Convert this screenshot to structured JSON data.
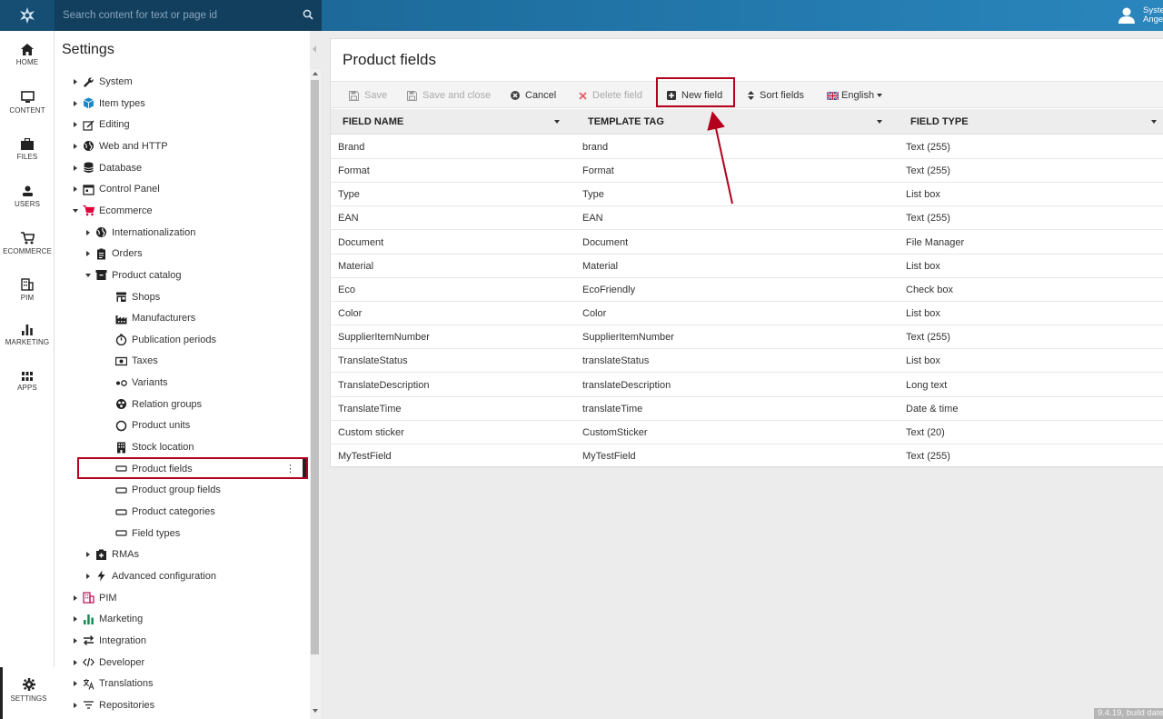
{
  "search": {
    "placeholder": "Search content for text or page id"
  },
  "user": {
    "line1": "System",
    "line2": "Angel"
  },
  "rail": [
    {
      "label": "HOME",
      "icon": "home-icon"
    },
    {
      "label": "CONTENT",
      "icon": "monitor-icon"
    },
    {
      "label": "FILES",
      "icon": "briefcase-icon"
    },
    {
      "label": "USERS",
      "icon": "user-icon"
    },
    {
      "label": "ECOMMERCE",
      "icon": "cart-icon"
    },
    {
      "label": "PIM",
      "icon": "building-icon"
    },
    {
      "label": "MARKETING",
      "icon": "bar-chart-icon"
    },
    {
      "label": "APPS",
      "icon": "grid-icon"
    }
  ],
  "rail_settings": {
    "label": "SETTINGS",
    "icon": "gear-icon"
  },
  "tree": {
    "title": "Settings",
    "nodes": [
      {
        "label": "System",
        "icon": "wrench-icon",
        "level": 0,
        "state": "collapsed"
      },
      {
        "label": "Item types",
        "icon": "cube-icon",
        "level": 0,
        "state": "collapsed"
      },
      {
        "label": "Editing",
        "icon": "edit-icon",
        "level": 0,
        "state": "collapsed"
      },
      {
        "label": "Web and HTTP",
        "icon": "globe-icon",
        "level": 0,
        "state": "collapsed"
      },
      {
        "label": "Database",
        "icon": "database-icon",
        "level": 0,
        "state": "collapsed"
      },
      {
        "label": "Control Panel",
        "icon": "calendar-icon",
        "level": 0,
        "state": "collapsed"
      },
      {
        "label": "Ecommerce",
        "icon": "cart-icon",
        "level": 0,
        "state": "expanded"
      },
      {
        "label": "Internationalization",
        "icon": "globe-icon",
        "level": 1,
        "state": "collapsed"
      },
      {
        "label": "Orders",
        "icon": "clipboard-icon",
        "level": 1,
        "state": "collapsed"
      },
      {
        "label": "Product catalog",
        "icon": "archive-icon",
        "level": 1,
        "state": "expanded"
      },
      {
        "label": "Shops",
        "icon": "store-icon",
        "level": 2,
        "state": "leaf"
      },
      {
        "label": "Manufacturers",
        "icon": "industry-icon",
        "level": 2,
        "state": "leaf"
      },
      {
        "label": "Publication periods",
        "icon": "timer-icon",
        "level": 2,
        "state": "leaf"
      },
      {
        "label": "Taxes",
        "icon": "money-icon",
        "level": 2,
        "state": "leaf"
      },
      {
        "label": "Variants",
        "icon": "variants-icon",
        "level": 2,
        "state": "leaf"
      },
      {
        "label": "Relation groups",
        "icon": "relation-icon",
        "level": 2,
        "state": "leaf"
      },
      {
        "label": "Product units",
        "icon": "circle-icon",
        "level": 2,
        "state": "leaf"
      },
      {
        "label": "Stock location",
        "icon": "building-icon",
        "level": 2,
        "state": "leaf"
      },
      {
        "label": "Product fields",
        "icon": "field-icon",
        "level": 2,
        "state": "leaf"
      },
      {
        "label": "Product group fields",
        "icon": "field-icon",
        "level": 2,
        "state": "leaf"
      },
      {
        "label": "Product categories",
        "icon": "field-icon",
        "level": 2,
        "state": "leaf"
      },
      {
        "label": "Field types",
        "icon": "field-icon",
        "level": 2,
        "state": "leaf"
      },
      {
        "label": "RMAs",
        "icon": "rma-icon",
        "level": 1,
        "state": "collapsed"
      },
      {
        "label": "Advanced configuration",
        "icon": "bolt-icon",
        "level": 1,
        "state": "collapsed"
      },
      {
        "label": "PIM",
        "icon": "pim-icon",
        "level": 0,
        "state": "collapsed"
      },
      {
        "label": "Marketing",
        "icon": "bar-chart-icon",
        "level": 0,
        "state": "collapsed"
      },
      {
        "label": "Integration",
        "icon": "exchange-icon",
        "level": 0,
        "state": "collapsed"
      },
      {
        "label": "Developer",
        "icon": "code-icon",
        "level": 0,
        "state": "collapsed"
      },
      {
        "label": "Translations",
        "icon": "translate-icon",
        "level": 0,
        "state": "collapsed"
      },
      {
        "label": "Repositories",
        "icon": "filter-icon",
        "level": 0,
        "state": "collapsed"
      }
    ]
  },
  "main": {
    "title": "Product fields",
    "toolbar": {
      "save": "Save",
      "save_close": "Save and close",
      "cancel": "Cancel",
      "delete": "Delete field",
      "new_field": "New field",
      "sort": "Sort fields",
      "language": "English"
    },
    "columns": [
      "FIELD NAME",
      "TEMPLATE TAG",
      "FIELD TYPE"
    ],
    "rows": [
      [
        "Brand",
        "brand",
        "Text (255)"
      ],
      [
        "Format",
        "Format",
        "Text (255)"
      ],
      [
        "Type",
        "Type",
        "List box"
      ],
      [
        "EAN",
        "EAN",
        "Text (255)"
      ],
      [
        "Document",
        "Document",
        "File Manager"
      ],
      [
        "Material",
        "Material",
        "List box"
      ],
      [
        "Eco",
        "EcoFriendly",
        "Check box"
      ],
      [
        "Color",
        "Color",
        "List box"
      ],
      [
        "SupplierItemNumber",
        "SupplierItemNumber",
        "Text (255)"
      ],
      [
        "TranslateStatus",
        "translateStatus",
        "List box"
      ],
      [
        "TranslateDescription",
        "translateDescription",
        "Long text"
      ],
      [
        "TranslateTime",
        "translateTime",
        "Date & time"
      ],
      [
        "Custom sticker",
        "CustomSticker",
        "Text (20)"
      ],
      [
        "MyTestField",
        "MyTestField",
        "Text (255)"
      ]
    ]
  },
  "version": "9.4.19, build date",
  "colors": {
    "highlight": "#b4001e",
    "topbar": "#1e6fa0",
    "cancel_icon": "#444",
    "delete_icon": "#e06060"
  }
}
